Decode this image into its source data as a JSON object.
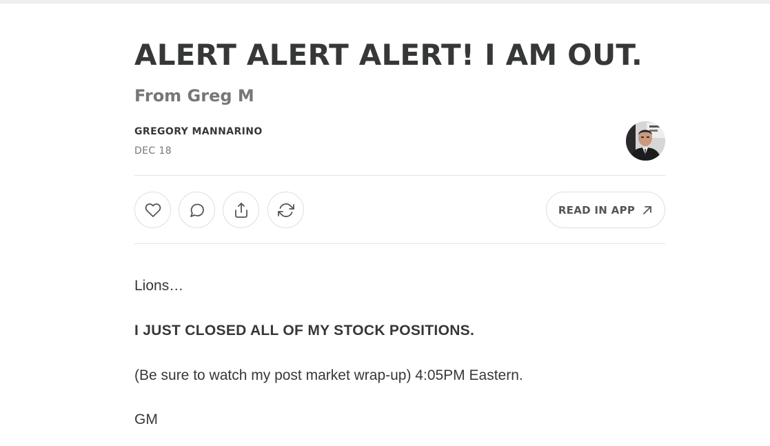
{
  "post": {
    "title": "ALERT ALERT ALERT! I AM OUT.",
    "subtitle": "From Greg M",
    "author": "GREGORY MANNARINO",
    "date": "DEC 18"
  },
  "actions": {
    "like_icon": "heart-icon",
    "comment_icon": "comment-icon",
    "share_icon": "share-icon",
    "restack_icon": "restack-icon",
    "read_in_app_label": "READ IN APP",
    "read_in_app_icon": "arrow-up-right-icon"
  },
  "body": {
    "paragraphs": [
      "Lions…",
      "I JUST CLOSED ALL OF MY STOCK POSITIONS.",
      "(Be sure to watch my post market wrap-up) 4:05PM Eastern.",
      "GM"
    ]
  },
  "colors": {
    "text": "#363737",
    "muted": "#777777",
    "border": "#dedede"
  }
}
